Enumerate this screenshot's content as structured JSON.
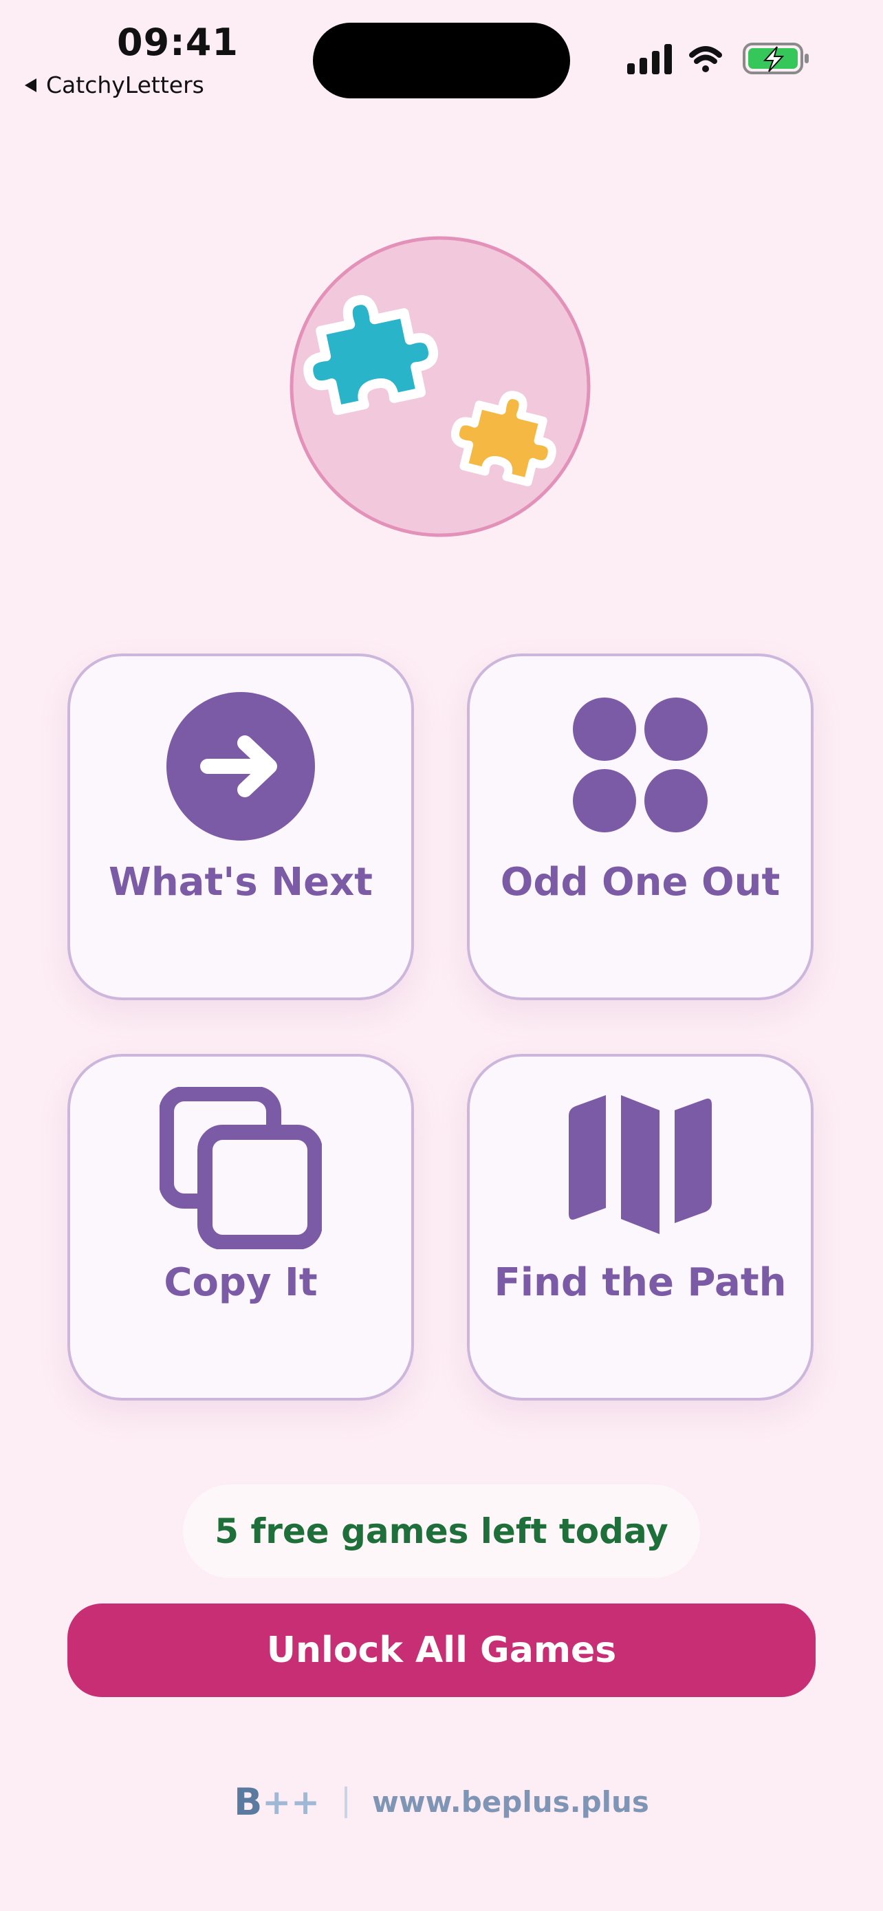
{
  "status_bar": {
    "time": "09:41",
    "back_app": "CatchyLetters"
  },
  "hero": {
    "icon": "puzzle-pieces-icon",
    "colors": {
      "circle_fill": "#f2c9dc",
      "circle_border": "#e391b8",
      "piece_blue": "#29b4c9",
      "piece_yellow": "#f5b843"
    }
  },
  "games": [
    {
      "label": "What's Next",
      "icon": "arrow-right-circle-icon"
    },
    {
      "label": "Odd One Out",
      "icon": "four-dots-icon"
    },
    {
      "label": "Copy It",
      "icon": "copy-icon"
    },
    {
      "label": "Find the Path",
      "icon": "map-icon"
    }
  ],
  "free_games_text": "5 free games left today",
  "unlock_button": "Unlock All Games",
  "footer": {
    "brand_letter": "B",
    "brand_plus": "++",
    "url": "www.beplus.plus"
  },
  "colors": {
    "background": "#fdedf4",
    "accent_purple": "#7b5aa6",
    "card_border": "#cdb6dc",
    "unlock": "#c82e74",
    "free_text": "#1f6f3a",
    "battery_green": "#35c759"
  }
}
